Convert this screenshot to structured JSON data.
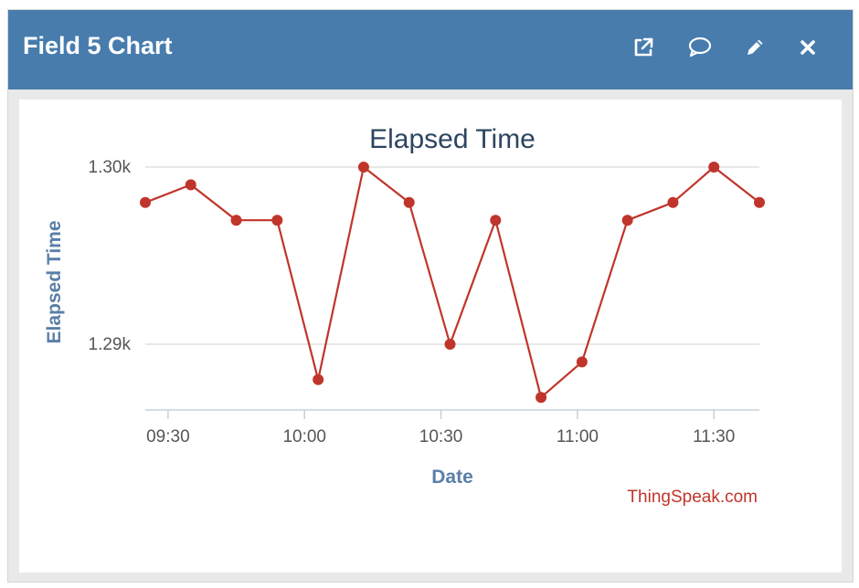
{
  "panel": {
    "title": "Field 5 Chart",
    "header_color": "#477cad",
    "icons": [
      {
        "name": "external-link-icon",
        "label": "open in new window"
      },
      {
        "name": "comment-icon",
        "label": "comment"
      },
      {
        "name": "pencil-icon",
        "label": "edit"
      },
      {
        "name": "close-icon",
        "label": "close"
      }
    ]
  },
  "chart_data": {
    "type": "line",
    "title": "Elapsed Time",
    "xlabel": "Date",
    "ylabel": "Elapsed Time",
    "credit": "ThingSpeak.com",
    "x_ticks": [
      "09:30",
      "10:00",
      "10:30",
      "11:00",
      "11:30"
    ],
    "y_ticks": [
      "1.30k",
      "1.29k"
    ],
    "y_tick_values": [
      1300,
      1290
    ],
    "series": [
      {
        "color": "#c0352b",
        "x": [
          "09:25",
          "09:35",
          "09:45",
          "09:54",
          "10:03",
          "10:13",
          "10:23",
          "10:32",
          "10:42",
          "10:52",
          "11:01",
          "11:11",
          "11:21",
          "11:30",
          "11:40"
        ],
        "y": [
          1298,
          1299,
          1297,
          1297,
          1288,
          1300,
          1298,
          1290,
          1297,
          1287,
          1289,
          1297,
          1298,
          1300,
          1298
        ]
      }
    ],
    "grid": true
  }
}
